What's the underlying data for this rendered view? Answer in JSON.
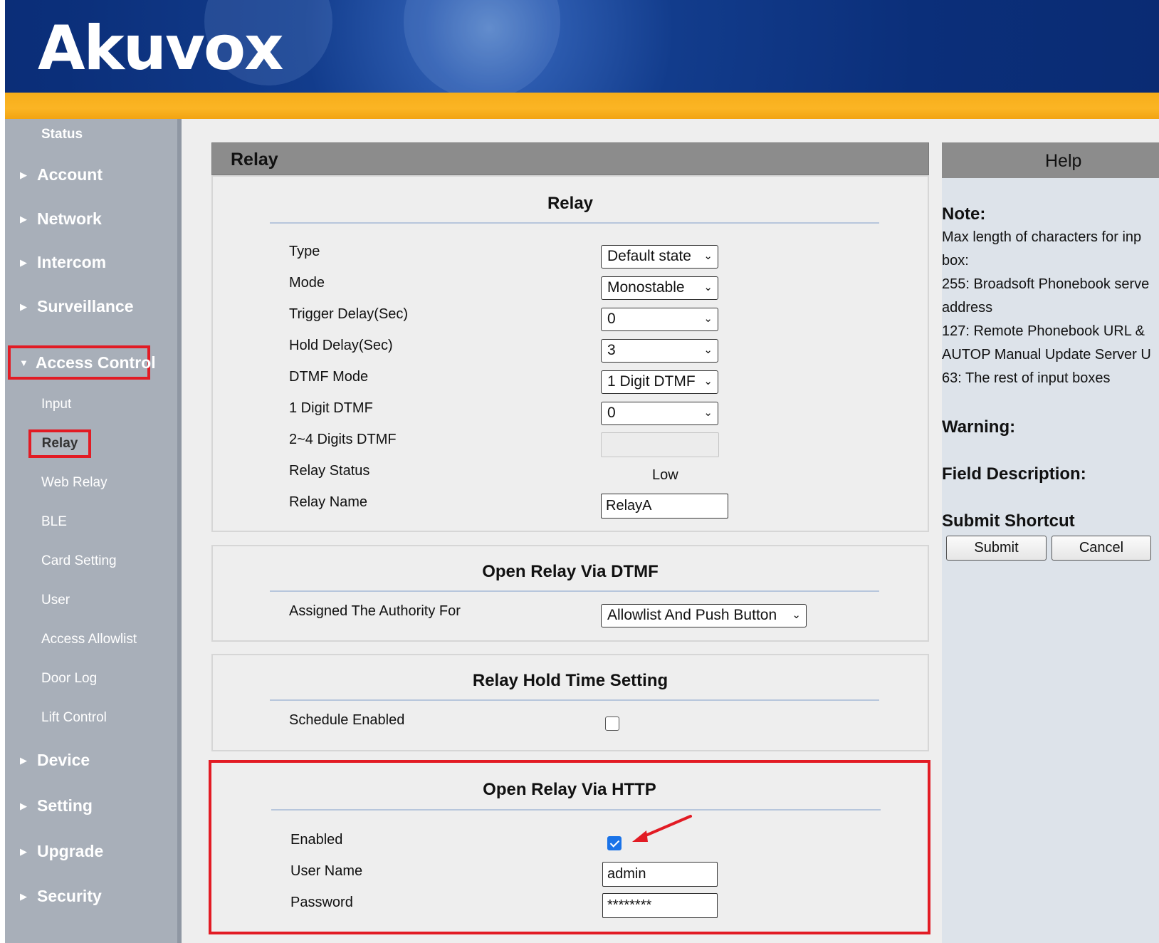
{
  "brand": {
    "logo_text": "Akuvox"
  },
  "sidebar": {
    "status": "Status",
    "items": [
      {
        "label": "Account"
      },
      {
        "label": "Network"
      },
      {
        "label": "Intercom"
      },
      {
        "label": "Surveillance"
      },
      {
        "label": "Access Control"
      },
      {
        "label": "Device"
      },
      {
        "label": "Setting"
      },
      {
        "label": "Upgrade"
      },
      {
        "label": "Security"
      }
    ],
    "sub_items": [
      {
        "label": "Input"
      },
      {
        "label": "Relay"
      },
      {
        "label": "Web Relay"
      },
      {
        "label": "BLE"
      },
      {
        "label": "Card Setting"
      },
      {
        "label": "User"
      },
      {
        "label": "Access Allowlist"
      },
      {
        "label": "Door Log"
      },
      {
        "label": "Lift Control"
      }
    ]
  },
  "page": {
    "title": "Relay"
  },
  "relay_section": {
    "title": "Relay",
    "type_label": "Type",
    "type_value": "Default state",
    "mode_label": "Mode",
    "mode_value": "Monostable",
    "trigger_label": "Trigger Delay(Sec)",
    "trigger_value": "0",
    "hold_label": "Hold Delay(Sec)",
    "hold_value": "3",
    "dtmf_mode_label": "DTMF Mode",
    "dtmf_mode_value": "1 Digit DTMF",
    "one_digit_label": "1 Digit DTMF",
    "one_digit_value": "0",
    "multi_digit_label": "2~4 Digits DTMF",
    "multi_digit_value": "",
    "status_label": "Relay Status",
    "status_value": "Low",
    "name_label": "Relay Name",
    "name_value": "RelayA"
  },
  "dtmf_section": {
    "title": "Open Relay Via DTMF",
    "authority_label": "Assigned The Authority For",
    "authority_value": "Allowlist And Push Button"
  },
  "hold_section": {
    "title": "Relay Hold Time Setting",
    "schedule_label": "Schedule Enabled",
    "schedule_enabled": false
  },
  "http_section": {
    "title": "Open Relay Via HTTP",
    "enabled_label": "Enabled",
    "enabled": true,
    "username_label": "User Name",
    "username_value": "admin",
    "password_label": "Password",
    "password_value": "********"
  },
  "help": {
    "title": "Help",
    "note_heading": "Note:",
    "note_lines": [
      "Max length of characters for inp",
      "box:",
      "255: Broadsoft Phonebook serve",
      "address",
      "127: Remote Phonebook URL &",
      "AUTOP Manual Update Server U",
      "63: The rest of input boxes"
    ],
    "warning_heading": "Warning:",
    "field_heading": "Field Description:",
    "shortcut_heading": "Submit Shortcut",
    "submit_label": "Submit",
    "cancel_label": "Cancel"
  },
  "colors": {
    "header_blue": "#0b2f7a",
    "band_orange": "#fbb524",
    "sidebar_gray": "#a8afb9",
    "highlight_red": "#e21b24",
    "checkbox_blue": "#1a73e8"
  }
}
